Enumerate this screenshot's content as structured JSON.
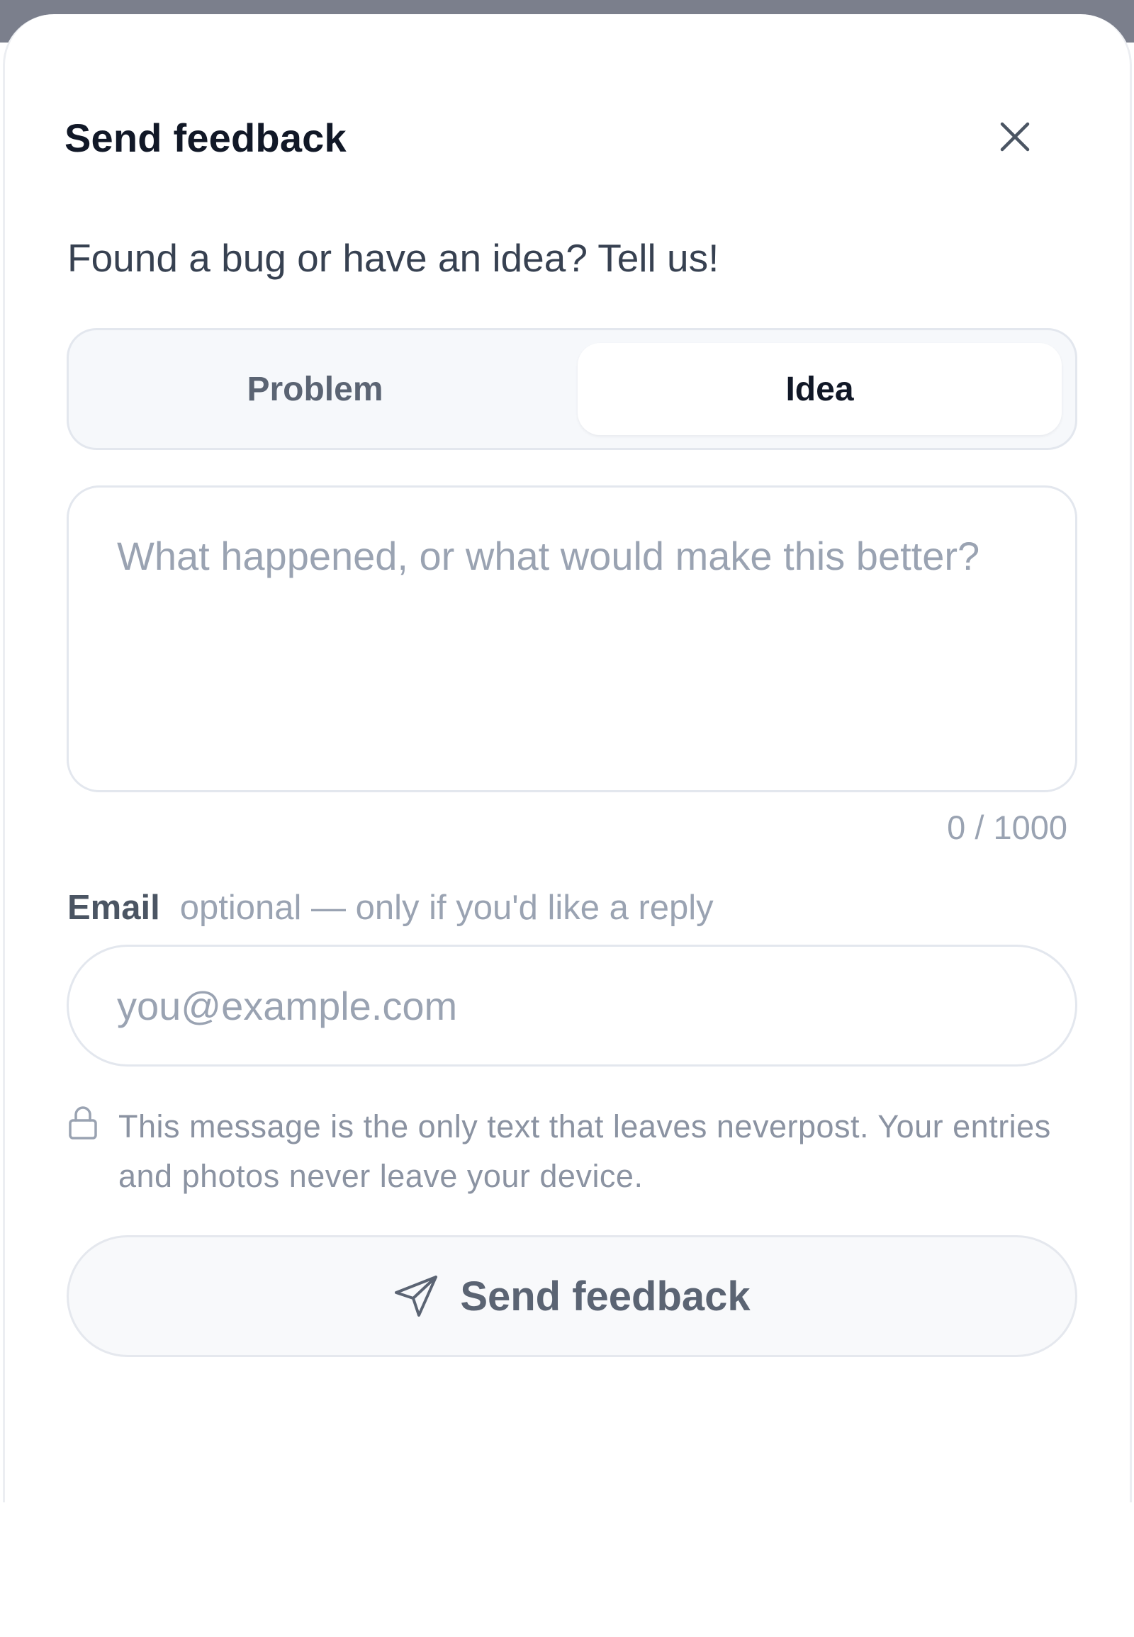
{
  "dialog": {
    "title": "Send feedback",
    "close_icon": "close-icon",
    "subtitle": "Found a bug or have an idea? Tell us!",
    "segments": [
      {
        "label": "Problem",
        "selected": false
      },
      {
        "label": "Idea",
        "selected": true
      }
    ],
    "message": {
      "placeholder": "What happened, or what would make this better?",
      "value": "",
      "counter": "0 / 1000"
    },
    "email": {
      "label": "Email",
      "hint": "optional — only if you'd like a reply",
      "placeholder": "you@example.com",
      "value": ""
    },
    "privacy": {
      "icon": "lock-icon",
      "text": "This message is the only text that leaves neverpost. Your entries and photos never leave your device."
    },
    "submit": {
      "icon": "send-icon",
      "label": "Send feedback"
    }
  },
  "colors": {
    "backdrop": "#7b7f8c",
    "title": "#111827",
    "muted": "#9aa3b2",
    "border": "#e3e7ee",
    "segment_bg": "#f6f8fb"
  }
}
